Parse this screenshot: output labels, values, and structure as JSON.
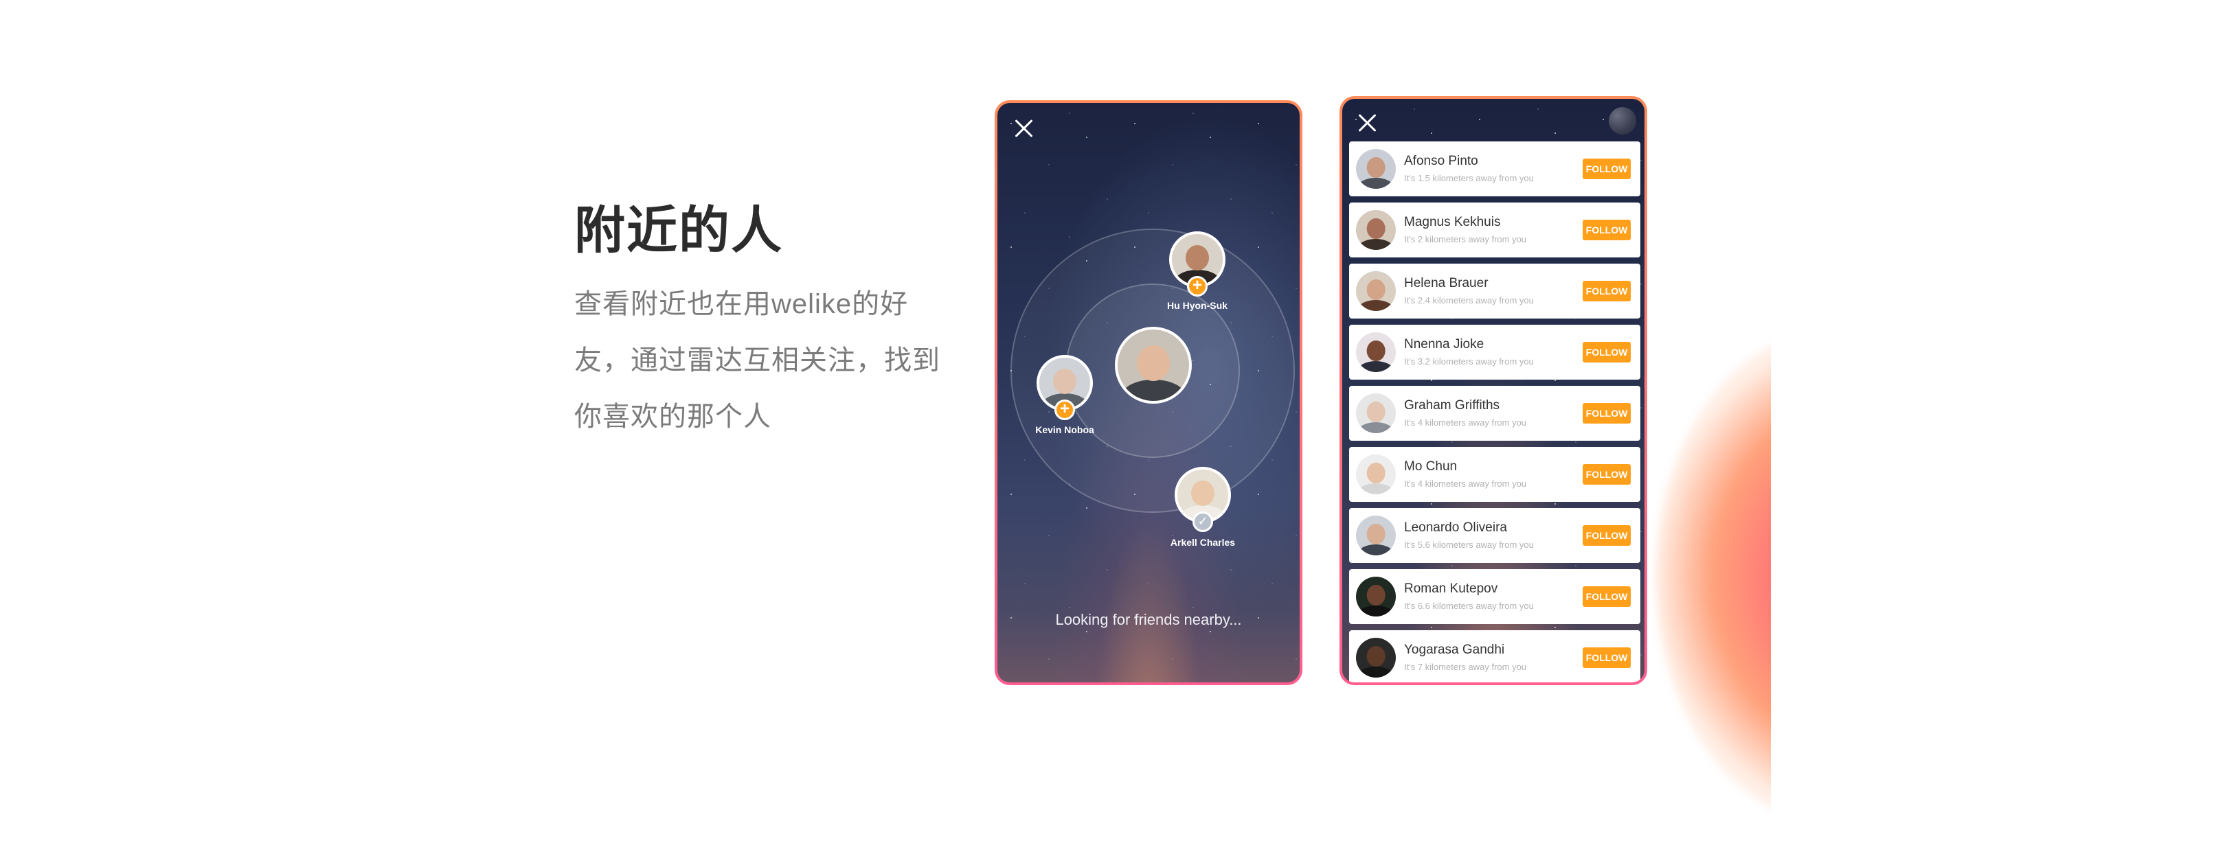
{
  "heading": "附近的人",
  "description": "查看附近也在用welike的好友，通过雷达互相关注，找到你喜欢的那个人",
  "colors": {
    "accent": "#ff9f1a",
    "frame_start": "#ff8a5a",
    "frame_end": "#ff5d8f"
  },
  "radar": {
    "center_user": {
      "name": "",
      "icon": "avatar-center"
    },
    "users": [
      {
        "name": "Hu Hyon-Suk",
        "status": "add",
        "badge": "+"
      },
      {
        "name": "Kevin Noboa",
        "status": "add",
        "badge": "+"
      },
      {
        "name": "Arkell Charles",
        "status": "followed",
        "badge": "✓"
      }
    ],
    "status_text": "Looking for friends nearby..."
  },
  "list": {
    "follow_label": "FOLLOW",
    "users": [
      {
        "name": "Afonso Pinto",
        "distance": "It's 1.5 kilometers away from you"
      },
      {
        "name": "Magnus Kekhuis",
        "distance": "It's 2 kilometers away from you"
      },
      {
        "name": "Helena Brauer",
        "distance": "It's 2.4 kilometers away from you"
      },
      {
        "name": "Nnenna Jioke",
        "distance": "It's 3.2 kilometers away from you"
      },
      {
        "name": "Graham Griffiths",
        "distance": "It's 4 kilometers away from you"
      },
      {
        "name": "Mo Chun",
        "distance": "It's 4 kilometers away from you"
      },
      {
        "name": "Leonardo Oliveira",
        "distance": "It's 5.6 kilometers away from you"
      },
      {
        "name": "Roman Kutepov",
        "distance": "It's 6.6 kilometers away from you"
      },
      {
        "name": "Yogarasa Gandhi",
        "distance": "It's 7 kilometers away from you"
      }
    ]
  }
}
